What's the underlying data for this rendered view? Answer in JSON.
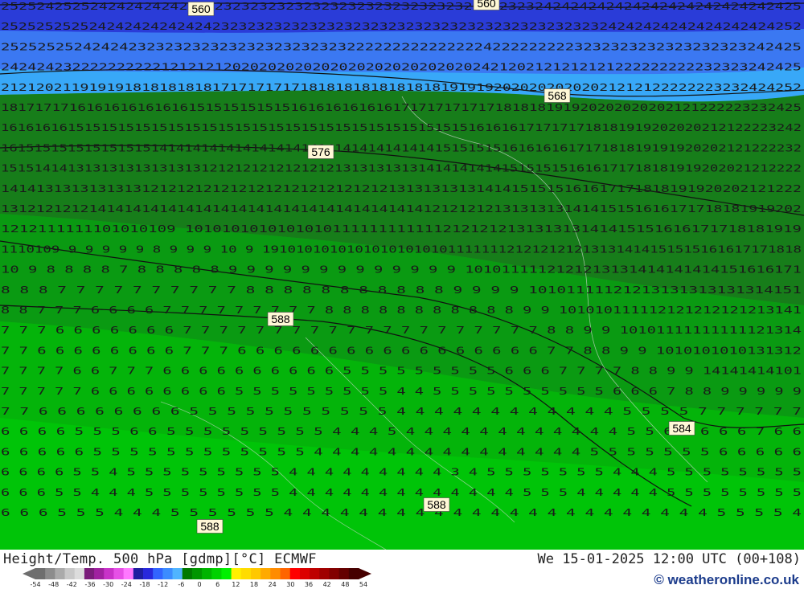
{
  "map": {
    "rows": [
      {
        "text": "252524252524242424242424232323232323232323232323232323232323242424242424242424242424242425"
      },
      {
        "text": "2525252525242424242424242323232323232323232323232323232323232323232324242424242424242424252"
      },
      {
        "text": "2525252524242423232323232323232323232322222222222222242222222223232323232323232323242425"
      },
      {
        "text": "242424232222222222121212120202020202020202020202020202421202121212121222222222232323242425"
      },
      {
        "text": "2121202119191918181818181717171717181818181818181819191920202020202021212122222223232424252"
      },
      {
        "text": "1817171716161616161616151515151515161616161616171717171717181818191920202020202121222223232425"
      },
      {
        "text": "161616161515151515151515151515151515151515151515151515151616161717171718181919202020212122223242"
      },
      {
        "text": "161515151515151515141414141414141414141414141414141415151515161616161717181819191920202121222232"
      },
      {
        "text": "151514141313131313131313121212121212121213131313131414141414151515151616171718181919202021212222"
      },
      {
        "text": "1414131313131313121212121212121212121212121213131313131414151515161617171818191920202121222"
      },
      {
        "text": "1312121212141414141414141414141414141414141414141212121213131313141415151616171718181919202"
      },
      {
        "text": "1212111111101010109 1010101010101010111111111111212121213131313141415151616171718181919"
      },
      {
        "text": "1110109 9 9 9 9 9 8 9 9 9 10 9 1910101010101010101010111111121212121213131414151515161617171818"
      },
      {
        "text": "10 9 8 8 8 8 7 8 8 8 8 8 9 9 9 9 9 9 9 9 9 9 9 9 9 1010111112121213131414141414151616171"
      },
      {
        "text": "8 8 8 7 7 7 7 7 7 7 7 7 7 8 8 8 8 8 8 8 8 8 8 8 9 9 9 9 10101111121213131313131314151"
      },
      {
        "text": "8 8 7 7 7 6 6 6 6 7 7 7 7 7 7 7 7 7 8 8 8 8 8 8 8 8 8 8 8 9 9 101010111112121212121213141"
      },
      {
        "text": "7 7 7 6 6 6 6 6 6 6 7 7 7 7 7 7 7 7 7 7 7 7 7 7 7 7 7 7 7 7 8 8 9 9 10101111111111121314"
      },
      {
        "text": "7 7 6 6 6 6 6 6 6 6 7 7 7 6 6 6 6 6 6 6 6 6 6 6 6 6 6 6 6 6 7 7 8 8 9 9 1010101010131312"
      },
      {
        "text": "7 7 7 7 6 6 7 7 7 6 6 6 6 6 6 6 6 6 6 5 5 5 5 5 5 5 5 5 6 6 6 7 7 7 7 8 8 9 9 14141414101"
      },
      {
        "text": "7 7 7 7 7 6 6 6 6 6 6 6 6 5 5 5 5 5 5 5 5 5 4 4 5 5 5 5 5 5 5 5 5 5 6 6 6 7 8 8 9 9 9 9 9"
      },
      {
        "text": "7 7 6 6 6 6 6 6 6 6 5 5 5 5 5 5 5 5 5 5 5 4 4 4 4 4 4 4 4 4 4 4 4 5 5 5 5 7 7 7 7 7 7"
      },
      {
        "text": "6 6 6 6 5 5 5 6 6 5 5 5 5 5 5 5 5 5 4 4 4 5 4 4 4 4 4 4 4 4 4 4 4 4 5 5 6 6 6 6 6 7 6 6"
      },
      {
        "text": "6 6 6 6 6 5 5 5 5 5 5 5 5 5 5 5 5 4 4 4 4 4 4 4 4 4 4 4 4 4 4 4 5 5 5 5 5 5 5 6 6 6 6 6"
      },
      {
        "text": "6 6 6 6 5 5 4 5 5 5 5 5 5 5 5 5 4 4 4 4 4 4 4 4 4 3 4 5 5 5 5 5 5 5 4 4 4 5 5 5 5 5 5 5 5"
      },
      {
        "text": "6 6 6 5 5 4 4 4 5 5 5 5 5 5 5 5 4 4 4 4 4 4 4 4 4 4 4 4 4 5 5 5 4 4 4 4 4 5 5 5 5 5 5 5 5"
      },
      {
        "text": "6 6 6 5 5 5 4 4 4 5 5 5 5 5 5 4 4 4 4 4 4 4 4 4 4 4 4 4 4 4 4 4 4 4 4 4 4 4 5 5 5 5 4"
      }
    ],
    "contour_labels": [
      {
        "text": "560"
      },
      {
        "text": "560"
      },
      {
        "text": "568"
      },
      {
        "text": "576"
      },
      {
        "text": "588"
      },
      {
        "text": "584"
      },
      {
        "text": "588"
      },
      {
        "text": "588"
      }
    ]
  },
  "footer": {
    "title": "Height/Temp. 500 hPa [gdmp][°C] ECMWF",
    "datetime": "We 15-01-2025 12:00 UTC (00+108)",
    "credit": "© weatheronline.co.uk"
  },
  "colorbar": {
    "ticks": [
      "-54",
      "-48",
      "-42",
      "-36",
      "-30",
      "-24",
      "-18",
      "-12",
      "-6",
      "0",
      "6",
      "12",
      "18",
      "24",
      "30",
      "36",
      "42",
      "48",
      "54"
    ],
    "colors": [
      "#6e6e6e",
      "#8c8c8c",
      "#aaaaaa",
      "#c8c8c8",
      "#dcdcdc",
      "#7a1c7a",
      "#a020a0",
      "#c832c8",
      "#e650e6",
      "#ff78ff",
      "#1e1ea0",
      "#2828dc",
      "#3264ff",
      "#3c8cff",
      "#50b4ff",
      "#007800",
      "#009600",
      "#00b400",
      "#00d200",
      "#00f000",
      "#fff000",
      "#ffdc00",
      "#ffc800",
      "#ffaa00",
      "#ff8c00",
      "#ff6400",
      "#ff0000",
      "#dc0000",
      "#be0000",
      "#a00000",
      "#820000",
      "#640000",
      "#460000"
    ]
  }
}
